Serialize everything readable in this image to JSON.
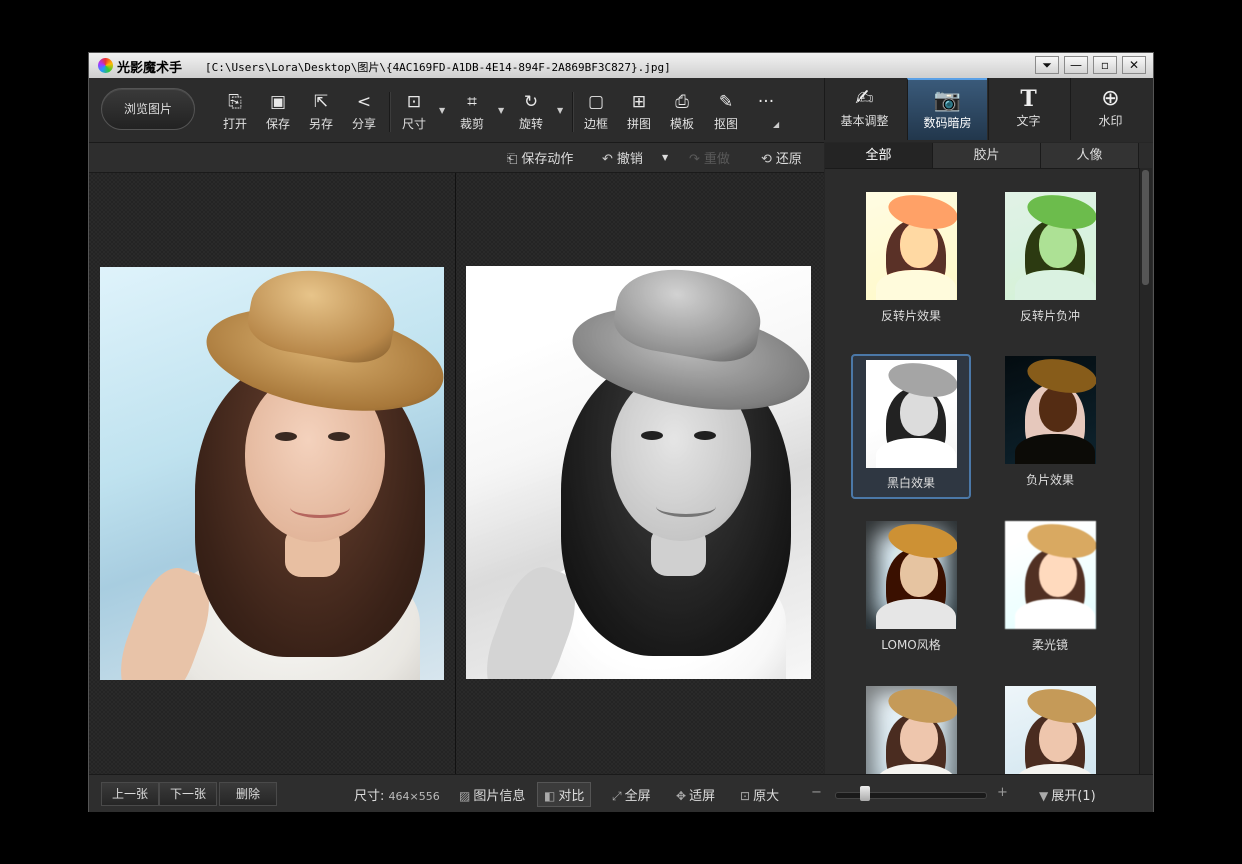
{
  "window": {
    "app_title": "光影魔术手",
    "file_path": "[C:\\Users\\Lora\\Desktop\\图片\\{4AC169FD-A1DB-4E14-894F-2A869BF3C827}.jpg]",
    "controls": {
      "menu": "⏷",
      "minimize": "—",
      "maximize": "▫",
      "close": "✕"
    }
  },
  "toolbar": {
    "browse": "浏览图片",
    "tools": [
      {
        "label": "打开",
        "icon": "open-icon"
      },
      {
        "label": "保存",
        "icon": "save-icon"
      },
      {
        "label": "另存",
        "icon": "save-as-icon"
      },
      {
        "label": "分享",
        "icon": "share-icon"
      },
      {
        "label": "尺寸",
        "icon": "resize-icon"
      },
      {
        "label": "裁剪",
        "icon": "crop-icon"
      },
      {
        "label": "旋转",
        "icon": "rotate-icon"
      },
      {
        "label": "边框",
        "icon": "border-icon"
      },
      {
        "label": "拼图",
        "icon": "collage-icon"
      },
      {
        "label": "模板",
        "icon": "template-icon"
      },
      {
        "label": "抠图",
        "icon": "cutout-icon"
      }
    ],
    "more": "···"
  },
  "modes": [
    {
      "label": "基本调整",
      "icon": "adjust-icon",
      "active": false
    },
    {
      "label": "数码暗房",
      "icon": "camera-icon",
      "active": true
    },
    {
      "label": "文字",
      "icon": "text-icon",
      "active": false
    },
    {
      "label": "水印",
      "icon": "watermark-icon",
      "active": false
    }
  ],
  "actions": {
    "save_action": "保存动作",
    "undo": "撤销",
    "redo": "重做",
    "restore": "还原"
  },
  "panel": {
    "tabs": [
      "全部",
      "胶片",
      "人像"
    ],
    "effects": [
      {
        "name": "反转片效果",
        "style": "rev"
      },
      {
        "name": "反转片负冲",
        "style": "revneg"
      },
      {
        "name": "黑白效果",
        "style": "bw",
        "selected": true
      },
      {
        "name": "负片效果",
        "style": "neg"
      },
      {
        "name": "LOMO风格",
        "style": "lomo"
      },
      {
        "name": "柔光镜",
        "style": "soft"
      },
      {
        "name": "",
        "style": "vig"
      },
      {
        "name": "",
        "style": "plain"
      }
    ]
  },
  "status": {
    "prev": "上一张",
    "next": "下一张",
    "delete": "删除",
    "size_label": "尺寸:",
    "size_value": "464×556",
    "info": "图片信息",
    "compare": "对比",
    "fullscreen": "全屏",
    "fit": "适屏",
    "original": "原大",
    "zoom_minus": "−",
    "zoom_plus": "+",
    "expand": "展开(1)"
  },
  "colors": {
    "accent": "#4b78a8",
    "active_mode": "#2d4863"
  }
}
